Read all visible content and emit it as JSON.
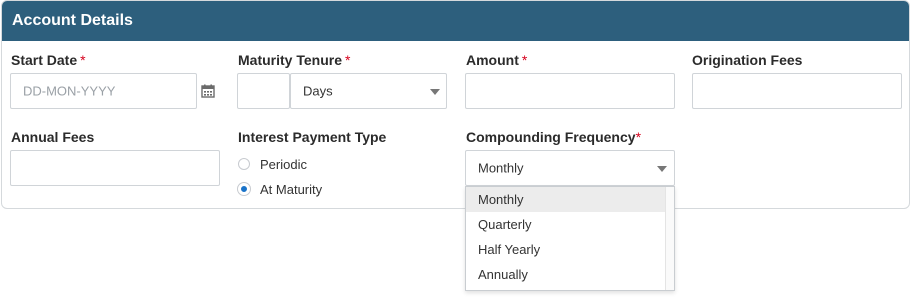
{
  "panel": {
    "title": "Account Details"
  },
  "fields": {
    "start_date": {
      "label": "Start Date",
      "required_mark": "*",
      "placeholder": "DD-MON-YYYY",
      "value": ""
    },
    "maturity_tenure": {
      "label": "Maturity Tenure",
      "required_mark": "*",
      "number_value": "",
      "unit_value": "Days"
    },
    "amount": {
      "label": "Amount",
      "required_mark": "*",
      "value": ""
    },
    "origination_fees": {
      "label": "Origination Fees",
      "value": ""
    },
    "annual_fees": {
      "label": "Annual Fees",
      "value": ""
    },
    "interest_payment_type": {
      "label": "Interest Payment Type",
      "options": [
        {
          "label": "Periodic",
          "selected": false
        },
        {
          "label": "At Maturity",
          "selected": true
        }
      ]
    },
    "compounding_frequency": {
      "label": "Compounding Frequency",
      "required_mark": "*",
      "value": "Monthly",
      "options": [
        "Monthly",
        "Quarterly",
        "Half Yearly",
        "Annually"
      ],
      "highlighted": "Monthly"
    }
  },
  "icons": {
    "calendar": "calendar-icon",
    "dropdown": "chevron-down-icon"
  },
  "colors": {
    "header_bg": "#2d5f7d",
    "required": "#d6001c",
    "radio_selected": "#1a73c9"
  }
}
